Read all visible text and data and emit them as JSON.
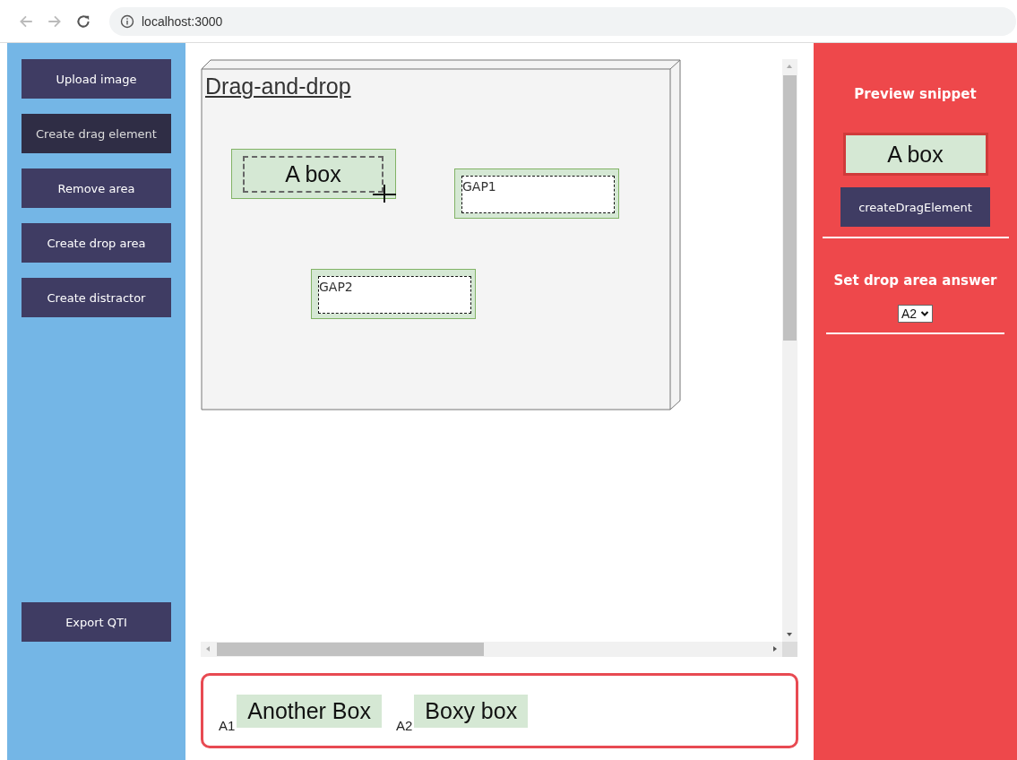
{
  "browser": {
    "url": "localhost:3000"
  },
  "toolbar": {
    "buttons": [
      {
        "label": "Upload image",
        "hovered": false
      },
      {
        "label": "Create drag element",
        "hovered": true
      },
      {
        "label": "Remove area",
        "hovered": false
      },
      {
        "label": "Create drop area",
        "hovered": false
      },
      {
        "label": "Create distractor",
        "hovered": false
      }
    ],
    "export_button": {
      "label": "Export QTI"
    }
  },
  "canvas": {
    "title": "Drag-and-drop",
    "drag_elements": [
      {
        "label": "A box",
        "selected": true
      }
    ],
    "drop_areas": [
      {
        "label": "GAP1"
      },
      {
        "label": "GAP2"
      }
    ]
  },
  "answers": [
    {
      "key": "A1",
      "label": "Another Box"
    },
    {
      "key": "A2",
      "label": "Boxy box"
    }
  ],
  "preview": {
    "title": "Preview snippet",
    "element": "A box",
    "button": "createDragElement"
  },
  "drop_answer": {
    "title": "Set drop area answer",
    "value": "A2"
  }
}
